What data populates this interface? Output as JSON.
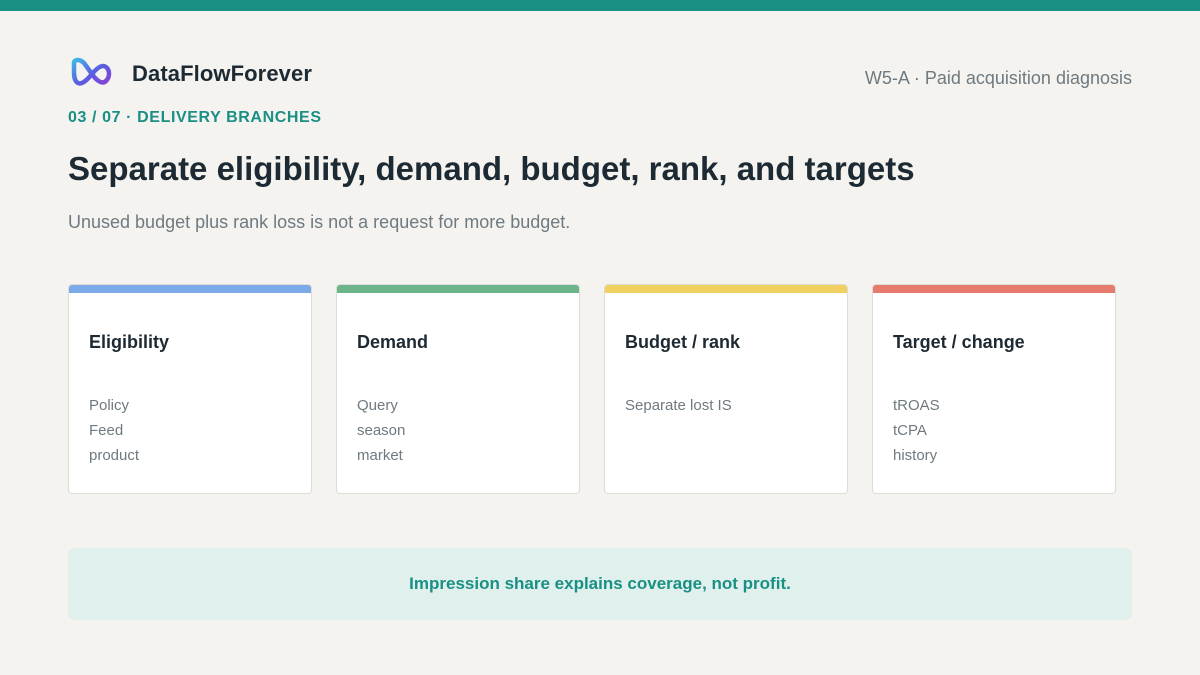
{
  "colors": {
    "top_bar": "#1a8f84",
    "accent_teal": "#1a8f84",
    "eligibility": "#7ca9e8",
    "demand": "#6cb58b",
    "budget_rank": "#f0d061",
    "target_change": "#e57a6d"
  },
  "header": {
    "brand_name": "DataFlowForever",
    "logo_icon": "infinity-loop-icon",
    "meta": "W5-A · Paid acquisition diagnosis"
  },
  "kicker": "03 / 07 · DELIVERY BRANCHES",
  "title": "Separate eligibility, demand, budget, rank, and targets",
  "subtitle": "Unused budget plus rank loss is not a request for more budget.",
  "cards": [
    {
      "title": "Eligibility",
      "lines": [
        "Policy",
        "Feed",
        "product"
      ]
    },
    {
      "title": "Demand",
      "lines": [
        "Query",
        "season",
        "market"
      ]
    },
    {
      "title": "Budget / rank",
      "lines": [
        "Separate lost IS"
      ]
    },
    {
      "title": "Target / change",
      "lines": [
        "tROAS",
        "tCPA",
        "history"
      ]
    }
  ],
  "callout": "Impression share explains coverage, not profit."
}
